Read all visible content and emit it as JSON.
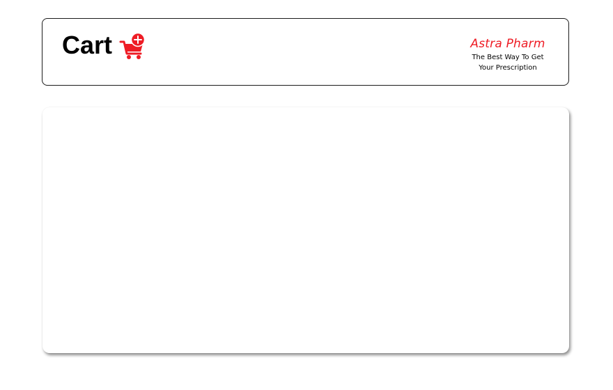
{
  "header": {
    "title": "Cart",
    "cart_icon": "cart-plus-icon",
    "brand": {
      "name": "Astra Pharm",
      "tagline_line1": "The Best Way To Get",
      "tagline_line2": "Your Prescription"
    }
  },
  "colors": {
    "accent": "#ee1c25",
    "text": "#000000",
    "border": "#1a1a1a"
  }
}
